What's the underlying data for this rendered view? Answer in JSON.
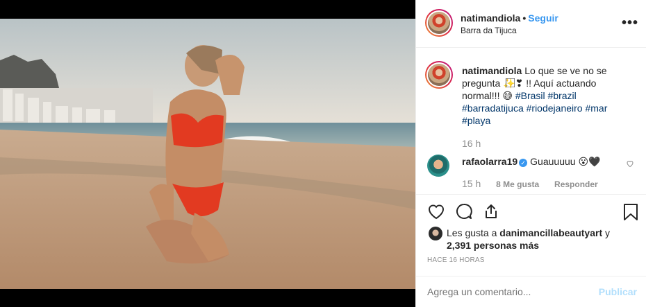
{
  "post": {
    "username": "natimandiola",
    "separator": "•",
    "follow_label": "Seguir",
    "location": "Barra da Tijuca",
    "more_label": "•••"
  },
  "caption": {
    "username": "natimandiola",
    "text_part1": "Lo que se ve no se pregunta ✨⃞⃞⃞❣ !! Aquí actuando normal!!! 😅",
    "hashtags": [
      "#Brasil",
      "#brazil",
      "#barradatijuca",
      "#riodejaneiro",
      "#mar",
      "#playa"
    ],
    "time": "16 h"
  },
  "comment": {
    "username": "rafaolarra19",
    "text": "Guauuuuu 😮🖤",
    "time": "15 h",
    "likes_label": "8 Me gusta",
    "reply_label": "Responder"
  },
  "likes": {
    "prefix": "Les gusta a",
    "liker": "danimancillabeautyart",
    "suffix": "y",
    "count_text": "2,391 personas más"
  },
  "age": "HACE 16 HORAS",
  "add_comment": {
    "placeholder": "Agrega un comentario...",
    "publish_label": "Publicar"
  },
  "icons": {
    "like": "heart-icon",
    "comment": "comment-icon",
    "share": "share-icon",
    "save": "bookmark-icon",
    "comment_like": "small-heart-icon",
    "verified": "verified-badge-icon"
  },
  "colors": {
    "accent": "#3897f0",
    "hashtag": "#003569",
    "muted": "#8e8e8e",
    "publish_disabled": "#b2dffc"
  }
}
